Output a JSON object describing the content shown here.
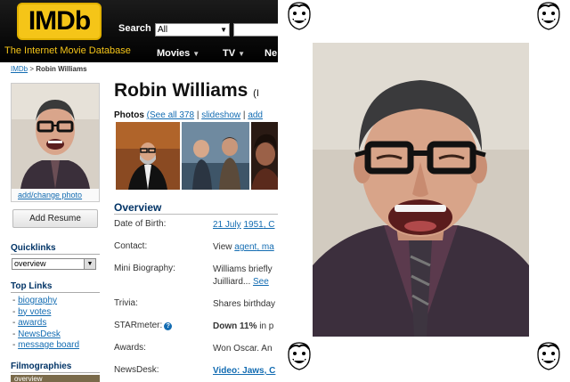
{
  "header": {
    "logo_text": "IMDb",
    "tagline": "The Internet Movie Database",
    "search_label": "Search",
    "search_select_value": "All",
    "nav": [
      {
        "label": "Movies"
      },
      {
        "label": "TV"
      },
      {
        "label": "Ne"
      }
    ]
  },
  "breadcrumb": {
    "home": "IMDb",
    "sep": ">",
    "current": "Robin Williams"
  },
  "sidebar": {
    "add_photo": "add/change photo",
    "add_resume": "Add Resume",
    "quicklinks_head": "Quicklinks",
    "quicklinks_value": "overview",
    "toplinks_head": "Top Links",
    "toplinks": [
      "biography",
      "by votes",
      "awards",
      "NewsDesk",
      "message board"
    ],
    "filmographies_head": "Filmographies",
    "filmographies_value": "overview"
  },
  "main": {
    "name": "Robin Williams",
    "name_suffix": "(I",
    "photos_label": "Photos",
    "photos_see_all": "(See all 378",
    "photos_sep1": "|",
    "photos_slideshow": "slideshow",
    "photos_sep2": "|",
    "photos_add": "add",
    "overview_head": "Overview",
    "rows": {
      "dob": {
        "label": "Date of Birth:",
        "v1": "21 July",
        "v2": "1951",
        "v3": ", C"
      },
      "contact": {
        "label": "Contact:",
        "v0": "View ",
        "v1": "agent",
        "v2": ", ma"
      },
      "bio": {
        "label": "Mini Biography:",
        "line1": "Williams briefly",
        "line2a": "Juilliard... ",
        "line2b": "See"
      },
      "trivia": {
        "label": "Trivia:",
        "value": "Shares birthday"
      },
      "starmeter": {
        "label": "STARmeter:",
        "q": "?",
        "bold": "Down 11%",
        "rest": " in p"
      },
      "awards": {
        "label": "Awards:",
        "value": "Won Oscar. An"
      },
      "newsdesk": {
        "label": "NewsDesk:",
        "value": "Video: Jaws, C"
      }
    }
  },
  "colors": {
    "accent": "#f5c518",
    "link": "#136cb2",
    "heading": "#003366"
  }
}
